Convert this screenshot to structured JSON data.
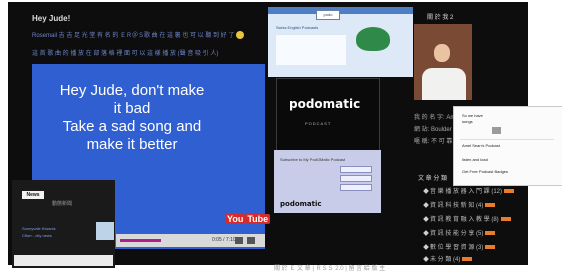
{
  "blog": {
    "title": "Hey Jude!",
    "line1": "Rosemail 吉 吉 足 光 堂 有 名 的 ＥＲ＠Ｓ歌 曲 在 這 裏 也 可 以 聽 到 好 了",
    "line2": "這 首 歌 曲 的 播 放 在 部 落 格 裡 面 可 以 這 樣 播 放 (聲 音 吸 引 人)"
  },
  "video": {
    "lyrics": [
      "Hey Jude, don't make",
      "it bad",
      "Take a sad song and",
      "make it better"
    ],
    "logo_part1": "You",
    "logo_part2": "Tube",
    "time": "0:05 / 7:10",
    "progress": 0.48
  },
  "news_widget": {
    "badge": "News",
    "text": "動態新聞",
    "links": [
      "Sunnyvale Kiwanis",
      "Cflorr - city news"
    ]
  },
  "site_screenshot": {
    "logo": "podo",
    "title": "Swiss English Podcasts"
  },
  "podomatic_dark": {
    "logo": "podomatic",
    "subtitle": "PODCAST"
  },
  "podomatic_form": {
    "title": "Subscribe to My PodOMatic Podcast",
    "logo": "podomatic"
  },
  "sidebar": {
    "about_title": "關 於 我 2",
    "profile_lines": [
      "我 的 名 字: Amber",
      "網 站: Boulder",
      "暱 稱: 不 可 靠 一 種"
    ],
    "category_title": "文 章 分 類",
    "categories": [
      {
        "label": "音 樂 播 放 器 入 門 課",
        "count": "(12)"
      },
      {
        "label": "資 訊 科 技 新 知",
        "count": "(4)"
      },
      {
        "label": "資 訊 教 育 融 入 教 學",
        "count": "(8)"
      },
      {
        "label": "資 訊 技 能 分 享",
        "count": "(5)"
      },
      {
        "label": "數 位 學 習 資 源",
        "count": "(3)"
      },
      {
        "label": "未 分 類",
        "count": "(4)"
      }
    ]
  },
  "podcast_widget": {
    "line1": "So we have",
    "line2": "songs",
    "title": "Amel Sean's Podcast",
    "item1": "listen and load",
    "item2": "Get Free Podcast Badges"
  },
  "footer": {
    "text": "關 於 Ｅ 文 章 | ＲＳＳ 2.0 | 留 言 給 版 主"
  }
}
